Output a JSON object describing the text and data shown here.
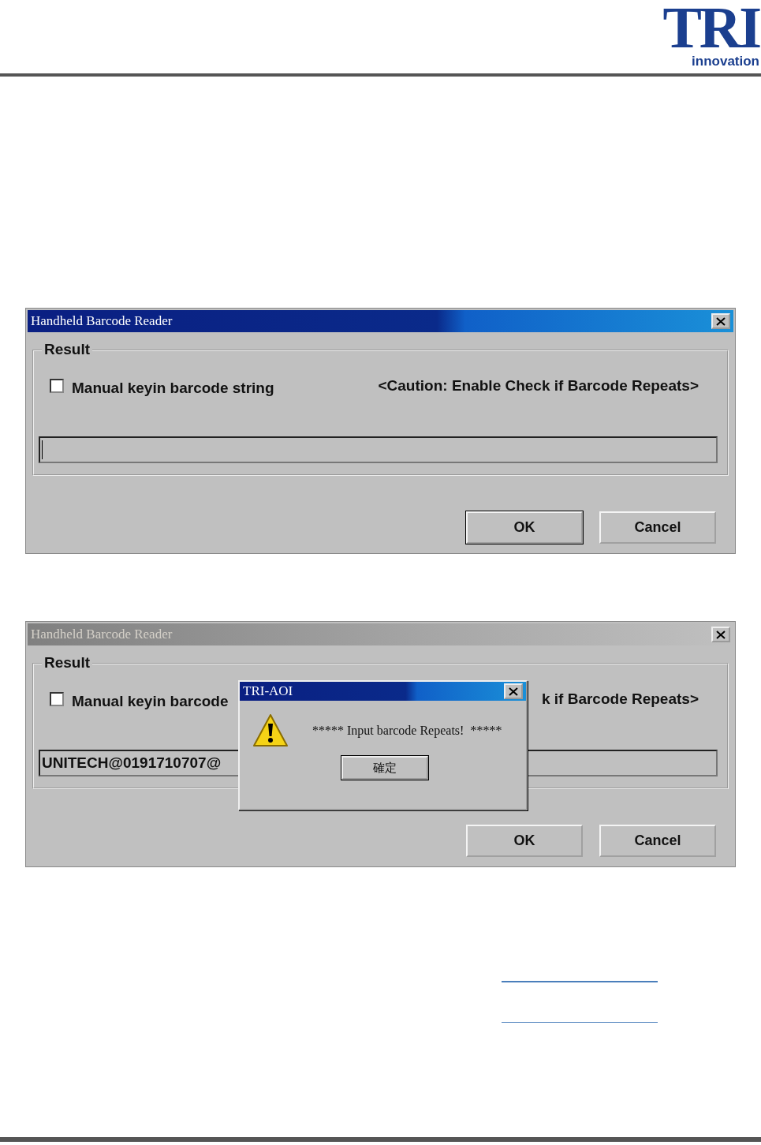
{
  "header": {
    "logo_text": "TRI",
    "logo_tagline": "innovation"
  },
  "dialogs": [
    {
      "title": "Handheld Barcode Reader",
      "active": true,
      "group_label": "Result",
      "checkbox": {
        "label": "Manual keyin barcode string",
        "checked": false
      },
      "caution": "<Caution: Enable Check if Barcode Repeats>",
      "field": {
        "focused": true
      },
      "buttons": [
        {
          "label": "OK",
          "default": true
        },
        {
          "label": "Cancel",
          "default": false
        }
      ]
    },
    {
      "title": "Handheld Barcode Reader",
      "active": false,
      "group_label": "Result",
      "checkbox": {
        "label": "Manual keyin barcode",
        "checked": false
      },
      "caution": "k if Barcode Repeats>",
      "field": {
        "value": "UNITECH@0191710707@",
        "focused": false
      },
      "buttons": [
        {
          "label": "OK",
          "default": false
        },
        {
          "label": "Cancel",
          "default": false
        }
      ],
      "message_box": {
        "title": "TRI-AOI",
        "text": "***** Input barcode Repeats!  *****",
        "button": "確定"
      }
    }
  ]
}
